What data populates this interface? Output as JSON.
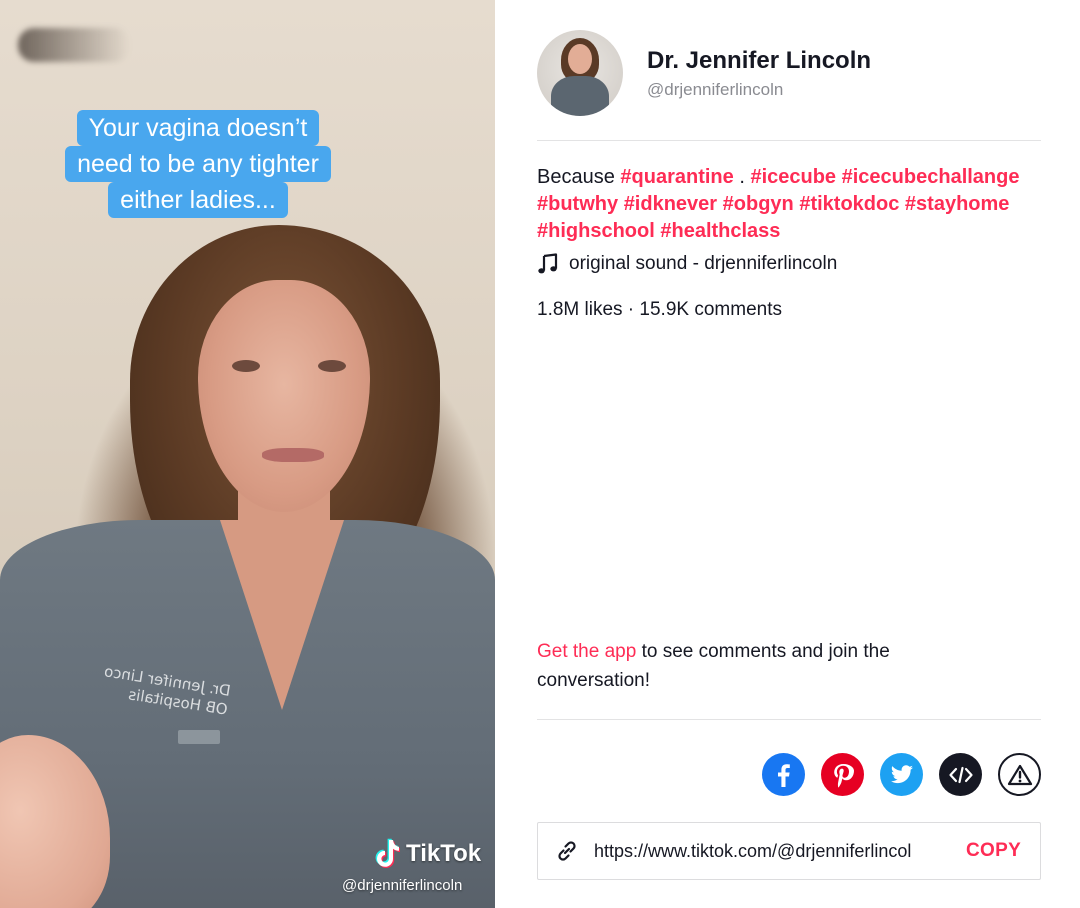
{
  "video": {
    "caption_lines": [
      "Your vagina doesn’t",
      "need to be any tighter",
      "either ladies..."
    ],
    "scrubs_embroidery_lines": [
      "Dr. Jennifer Linco",
      "OB Hospitalis"
    ],
    "watermark_brand": "TikTok",
    "watermark_handle": "@drjenniferlincoln"
  },
  "author": {
    "name": "Dr. Jennifer Lincoln",
    "handle": "@drjenniferlincoln"
  },
  "description": {
    "prefix": "Because",
    "tags": [
      "#quarantine",
      "#icecube",
      "#icecubechallange",
      "#butwhy",
      "#idknever",
      "#obgyn",
      "#tiktokdoc",
      "#stayhome",
      "#highschool",
      "#healthclass"
    ],
    "separator": "."
  },
  "sound": {
    "icon": "music-note-icon",
    "label": "original sound - drjenniferlincoln"
  },
  "stats": {
    "text": "1.8M likes · 15.9K comments"
  },
  "get_app": {
    "link_text": "Get the app",
    "rest_text": " to see comments and join the conversation!"
  },
  "share": {
    "buttons": [
      {
        "name": "facebook",
        "icon": "facebook-icon",
        "color": "#1877f2"
      },
      {
        "name": "pinterest",
        "icon": "pinterest-icon",
        "color": "#e60023"
      },
      {
        "name": "twitter",
        "icon": "twitter-icon",
        "color": "#1da1f2"
      },
      {
        "name": "embed",
        "icon": "embed-code-icon",
        "color": "#161823"
      },
      {
        "name": "report",
        "icon": "warning-icon",
        "color": "#161823"
      }
    ]
  },
  "copy_link": {
    "url": "https://www.tiktok.com/@drjenniferlincol",
    "button_label": "COPY"
  },
  "colors": {
    "accent": "#fe2c55",
    "caption_bg": "#49a7ee",
    "text": "#161823",
    "muted": "#8a8b91"
  }
}
